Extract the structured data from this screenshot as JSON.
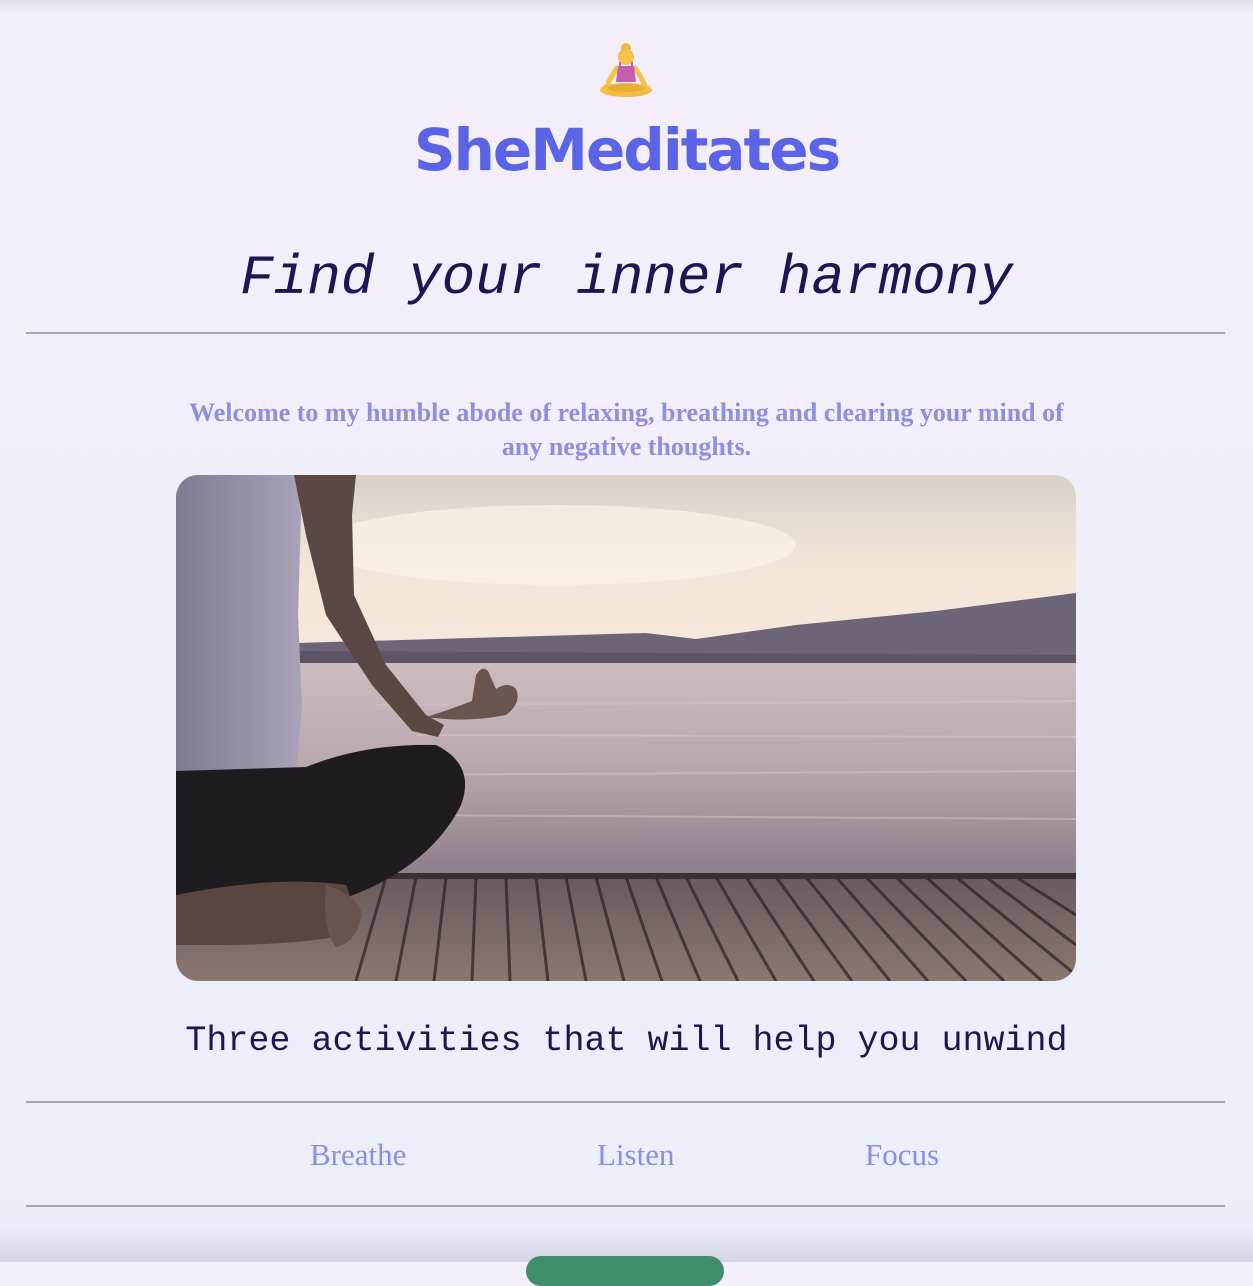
{
  "header": {
    "logo_icon": "woman-in-lotus-position-icon",
    "brand": "SheMeditates",
    "tagline": "Find your inner harmony"
  },
  "intro": {
    "welcome_text": "Welcome to my humble abode of relaxing, breathing and clearing your mind of any negative thoughts."
  },
  "hero_image": {
    "description": "woman-meditating-on-pier-icon"
  },
  "activities": {
    "heading": "Three activities that will help you unwind",
    "nav": [
      {
        "label": "Breathe"
      },
      {
        "label": "Listen"
      },
      {
        "label": "Focus"
      }
    ]
  },
  "colors": {
    "brand": "#5b63e6",
    "heading": "#1e1650",
    "accent_text": "#8f8ee0",
    "link": "#8b8ee2",
    "background": "#f1eefb",
    "rule": "#a9a6ab",
    "button": "#3f8f6e"
  }
}
